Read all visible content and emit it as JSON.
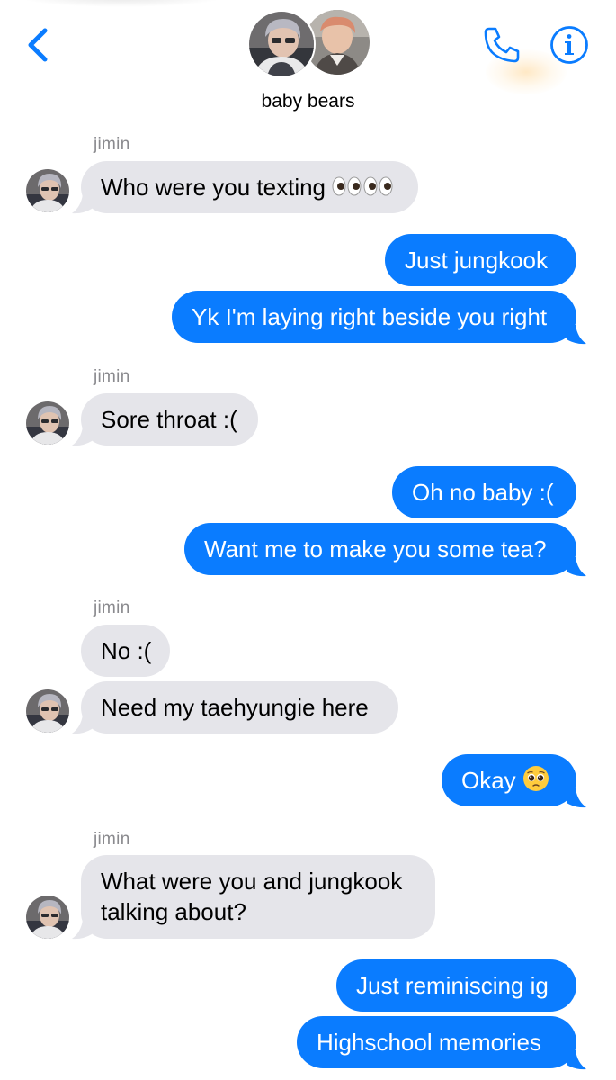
{
  "header": {
    "title": "baby bears",
    "back_icon": "chevron-left-icon",
    "call_icon": "phone-icon",
    "info_icon": "info-icon",
    "accent_color": "#0a7cff"
  },
  "messages": [
    {
      "sender": "jimin",
      "direction": "in",
      "text": "Who were you texting",
      "emoji": "eyes-emoji-x4"
    },
    {
      "direction": "out",
      "text": "Just jungkook"
    },
    {
      "direction": "out",
      "text": "Yk I'm laying right beside you right"
    },
    {
      "sender": "jimin",
      "direction": "in",
      "text": "Sore throat :("
    },
    {
      "direction": "out",
      "text": "Oh no baby :("
    },
    {
      "direction": "out",
      "text": "Want me to make you some tea?"
    },
    {
      "sender": "jimin",
      "direction": "in",
      "text": "No :("
    },
    {
      "direction": "in",
      "text": "Need my taehyungie here"
    },
    {
      "direction": "out",
      "text": "Okay",
      "emoji": "pleading-face-emoji"
    },
    {
      "sender": "jimin",
      "direction": "in",
      "text_line1": "What were you and jungkook",
      "text_line2": "talking about?"
    },
    {
      "direction": "out",
      "text": "Just reminiscing ig"
    },
    {
      "direction": "out",
      "text": "Highschool memories"
    }
  ],
  "colors": {
    "incoming_bubble": "#e5e5ea",
    "outgoing_bubble": "#0a7cff",
    "sender_label": "#8a8a8e"
  }
}
